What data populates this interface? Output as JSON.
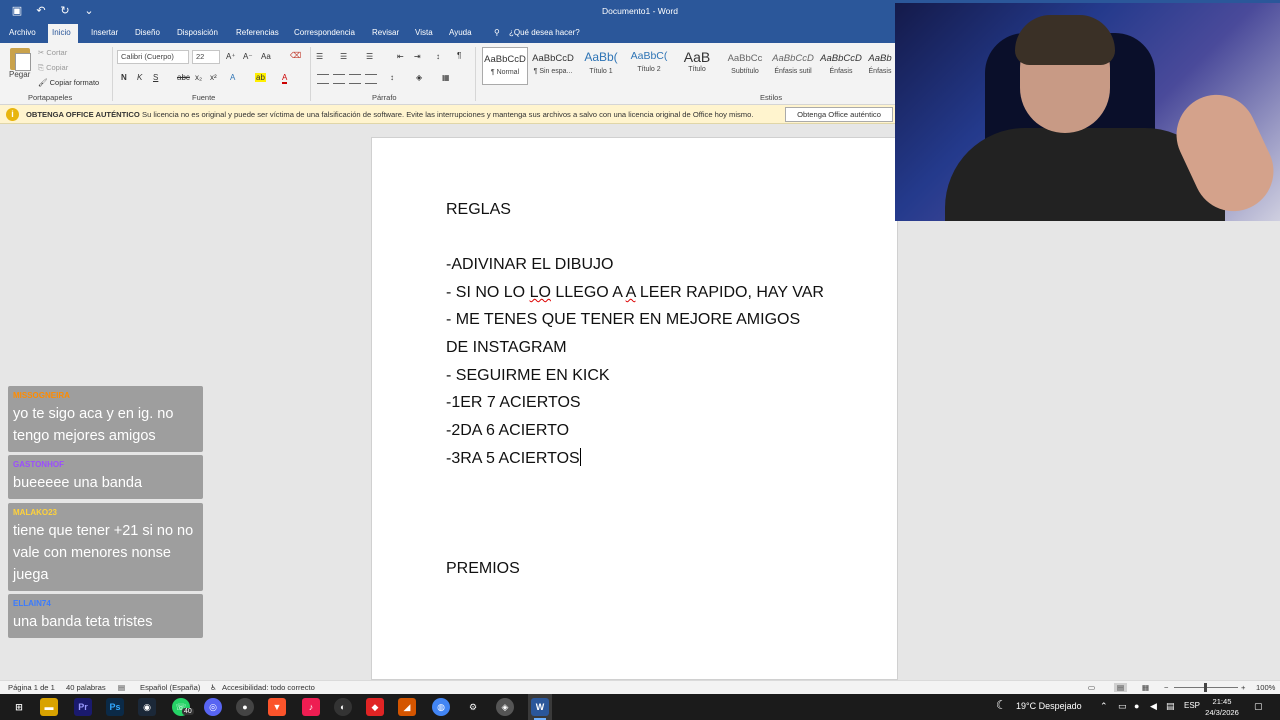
{
  "window": {
    "title": "Documento1  -  Word"
  },
  "tabs": [
    "Archivo",
    "Inicio",
    "Insertar",
    "Diseño",
    "Disposición",
    "Referencias",
    "Correspondencia",
    "Revisar",
    "Vista",
    "Ayuda"
  ],
  "tell_me": "¿Qué desea hacer?",
  "ribbon": {
    "clipboard": {
      "paste": "Pegar",
      "cut": "Cortar",
      "copy": "Copiar",
      "format_painter": "Copiar formato",
      "label": "Portapapeles"
    },
    "font": {
      "family": "Calibri (Cuerpo)",
      "size": "22",
      "bold": "N",
      "italic": "K",
      "underline": "S",
      "label": "Fuente"
    },
    "paragraph": {
      "label": "Párrafo"
    },
    "styles": {
      "label": "Estilos",
      "items": [
        {
          "preview": "AaBbCcD",
          "name": "¶ Normal"
        },
        {
          "preview": "AaBbCcD",
          "name": "¶ Sin espa..."
        },
        {
          "preview": "AaBb(",
          "name": "Título 1"
        },
        {
          "preview": "AaBbC(",
          "name": "Título 2"
        },
        {
          "preview": "AaB",
          "name": "Título"
        },
        {
          "preview": "AaBbCc",
          "name": "Subtítulo"
        },
        {
          "preview": "AaBbCcD",
          "name": "Énfasis sutil"
        },
        {
          "preview": "AaBbCcD",
          "name": "Énfasis"
        },
        {
          "preview": "AaBb",
          "name": "Énfasis"
        }
      ]
    }
  },
  "license_bar": {
    "title": "OBTENGA OFFICE AUTÉNTICO",
    "message": "Su licencia no es original y puede ser víctima de una falsificación de software. Evite las interrupciones y mantenga sus archivos a salvo con una licencia original de Office hoy mismo.",
    "button": "Obtenga Office auténtico"
  },
  "document": {
    "lines": [
      "REGLAS",
      "",
      "-ADIVINAR EL DIBUJO",
      "- SI NO LO LO LLEGO A A LEER RAPIDO, HAY VAR",
      "- ME TENES QUE TENER EN MEJORE AMIGOS",
      "DE INSTAGRAM",
      "- SEGUIRME EN KICK",
      "-1ER 7 ACIERTOS",
      "-2DA 6 ACIERTO",
      "-3RA 5 ACIERTOS",
      "",
      "",
      "",
      "PREMIOS"
    ]
  },
  "chat": [
    {
      "user": "MISSOGNEIRA",
      "color": "#ff8c00",
      "text": "yo te sigo aca y en ig. no tengo mejores amigos"
    },
    {
      "user": "GASTONHOF",
      "color": "#9b4dff",
      "text": "bueeeee una banda"
    },
    {
      "user": "MALAKO23",
      "color": "#ffd23a",
      "text": "tiene que tener +21 si no no vale con menores nonse juega"
    },
    {
      "user": "ELLAIN74",
      "color": "#3a7bff",
      "text": "una banda teta tristes"
    }
  ],
  "status_bar": {
    "page": "Página 1 de 1",
    "words": "40 palabras",
    "language": "Español (España)",
    "accessibility": "Accesibilidad: todo correcto",
    "zoom": "100%"
  },
  "taskbar": {
    "weather": "19°C  Despejado",
    "lang": "ESP",
    "time": "21:45",
    "date": "24/3/2026",
    "whatsapp_badge": "40"
  },
  "colors": {
    "word_blue": "#2b579a",
    "license_bar": "#fff4ce",
    "taskbar": "#1b1b1b"
  }
}
